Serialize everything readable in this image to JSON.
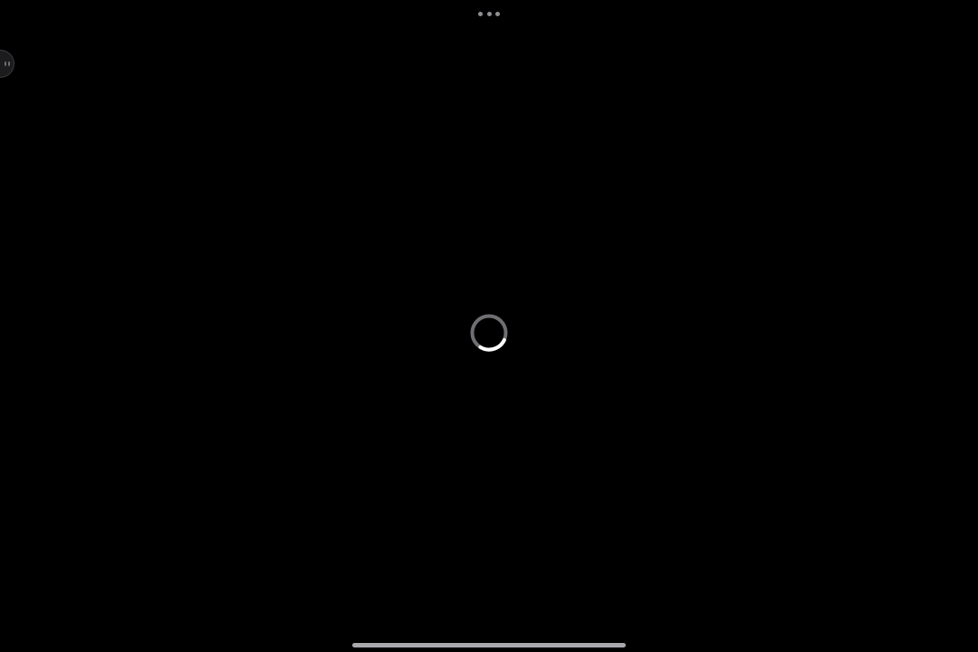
{
  "screen": {
    "background": "#000000"
  },
  "multitask_menu": {
    "icon": "ellipsis-icon",
    "dot_color": "#8e8e93"
  },
  "edge_button": {
    "icon": "face-icon",
    "background": "#1c1c1e"
  },
  "loading": {
    "icon": "spinner-icon",
    "track_color": "#6e6e73",
    "arc_color": "#ffffff"
  },
  "home_indicator": {
    "color": "#a8a8ad"
  }
}
